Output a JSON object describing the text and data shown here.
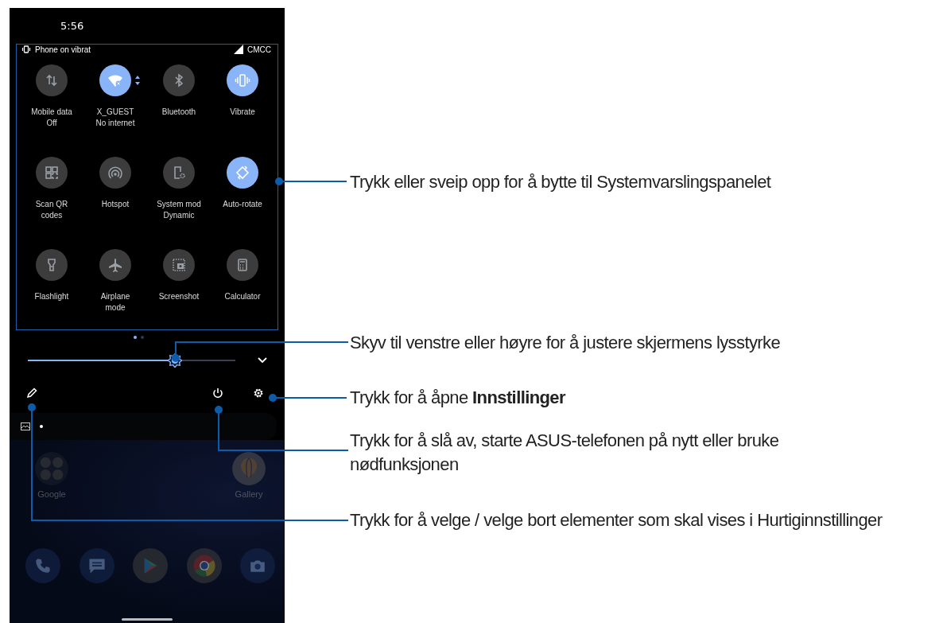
{
  "status_bar": {
    "time": "5:56"
  },
  "quick_settings": {
    "status_text": "Phone on vibrat",
    "carrier": "CMCC",
    "tiles": [
      {
        "label": "Mobile data",
        "sublabel": "Off",
        "on": false,
        "expandable": false
      },
      {
        "label": "X_GUEST",
        "sublabel": "No internet",
        "on": true,
        "expandable": true
      },
      {
        "label": "Bluetooth",
        "on": false,
        "expandable": false
      },
      {
        "label": "Vibrate",
        "on": true,
        "expandable": false
      },
      {
        "label": "Scan QR codes",
        "on": false,
        "expandable": false
      },
      {
        "label": "Hotspot",
        "on": false,
        "expandable": false
      },
      {
        "label": "System mod",
        "sublabel": "Dynamic",
        "on": false,
        "expandable": false
      },
      {
        "label": "Auto-rotate",
        "on": true,
        "expandable": false
      },
      {
        "label": "Flashlight",
        "on": false,
        "expandable": false
      },
      {
        "label": "Airplane mode",
        "on": false,
        "expandable": false
      },
      {
        "label": "Screenshot",
        "on": false,
        "expandable": false
      },
      {
        "label": "Calculator",
        "on": false,
        "expandable": false
      }
    ],
    "pages": [
      {
        "selected": true
      },
      {
        "selected": false
      }
    ]
  },
  "brightness": {
    "level": 0.71
  },
  "home_screen": {
    "apps": [
      {
        "label": "Google"
      },
      {
        "label": "Gallery"
      }
    ]
  },
  "annotations": [
    {
      "text": "Trykk eller sveip opp for å bytte til Systemvarslingspanelet"
    },
    {
      "text": "Skyv til venstre eller høyre for å justere skjermens lysstyrke"
    },
    {
      "text": "Trykk for å åpne **Innstillinger**"
    },
    {
      "text": "Trykk for å slå av, starte ASUS-telefonen på nytt eller bruke nødfunksjonen"
    },
    {
      "text": "Trykk for å velge / velge bort elementer som skal vises i Hurtiginnstillinger"
    }
  ]
}
